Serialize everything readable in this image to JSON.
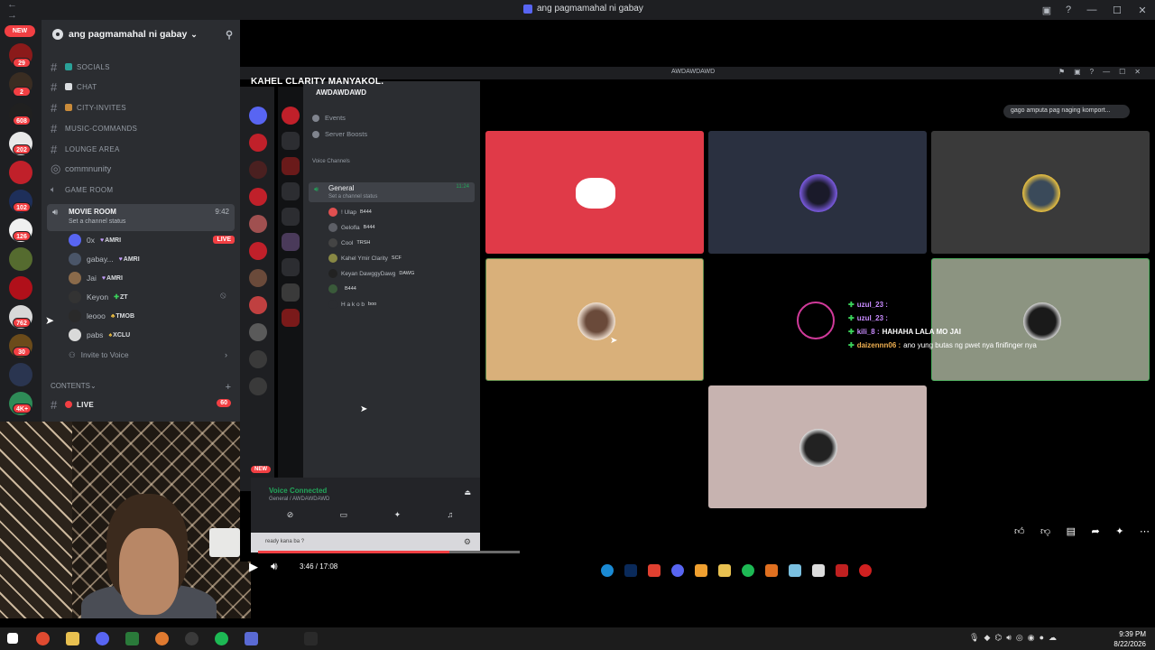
{
  "window": {
    "title": "ang pagmamahal ni gabay",
    "nav": "← →"
  },
  "rail": {
    "new_label": "NEW",
    "badges": [
      "29",
      "2",
      "608",
      "202",
      "102",
      "126",
      "762",
      "30",
      "4K+"
    ]
  },
  "server": {
    "name": "ang pagmamahal ni gabay",
    "channels": [
      {
        "label": "SOCIALS"
      },
      {
        "label": "CHAT"
      },
      {
        "label": "CITY-INVITES"
      },
      {
        "label": "MUSIC-COMMANDS"
      },
      {
        "label": "LOUNGE AREA"
      },
      {
        "label": "commnunity"
      },
      {
        "label": "GAME ROOM"
      }
    ],
    "movie_room": {
      "name": "MOVIE ROOM",
      "status": "Set a channel status",
      "time": "9:42"
    },
    "voice_users": [
      {
        "name": "0x",
        "tag": "AMRI",
        "live": "LIVE"
      },
      {
        "name": "gabay...",
        "tag": "AMRI"
      },
      {
        "name": "Jai",
        "tag": "AMRI"
      },
      {
        "name": "Keyon",
        "tag": "ZT"
      },
      {
        "name": "leooo",
        "tag": "TMOB"
      },
      {
        "name": "pabs",
        "tag": "XCLU"
      }
    ],
    "invite": "Invite to Voice",
    "contents_category": "CONTENTS",
    "live_channel": {
      "label": "LIVE",
      "count": "60"
    }
  },
  "share": {
    "overlay_title": "KAHEL CLARITY MANYAKOL.",
    "inner_window_title": "AWDAWDAWD",
    "inner_server": "AWDAWDAWD",
    "events": "Events",
    "boosts": "Server Boosts",
    "voice_category": "Voice Channels",
    "general": {
      "name": "General",
      "status": "Set a channel status",
      "time": "11:24"
    },
    "inner_users": [
      {
        "name": "! Ulap",
        "tag": "B444"
      },
      {
        "name": "Gelofla",
        "tag": "B444"
      },
      {
        "name": "Cool",
        "tag": "TRSH"
      },
      {
        "name": "Kahel Ymir Clarity",
        "tag": "SCF"
      },
      {
        "name": "Keyan DawggyDawg",
        "tag": "DAWG"
      },
      {
        "name": "",
        "tag": "B444"
      },
      {
        "name": "H a k o b",
        "tag": "boo"
      }
    ],
    "voice_connected": "Voice Connected",
    "voice_sub": "General / AWDAWDAWD",
    "new_label": "NEW",
    "user_line": "ready kana ba ?",
    "progress": 0.73
  },
  "player": {
    "time": "3:46 / 17:08",
    "progress_fraction": 0.22
  },
  "notification": "gago amputa pag naging komport...",
  "chat": [
    {
      "name": "uzul_23 :",
      "msg": "",
      "color": "#c98bff"
    },
    {
      "name": "uzul_23 :",
      "msg": "",
      "color": "#c98bff"
    },
    {
      "name": "kili_8 :",
      "msg": "HAHAHA LALA MO JAI",
      "color": "#c98bff"
    },
    {
      "name": "daizennn06 :",
      "msg": "ano yung butas ng pwet nya finifinger nya",
      "color": "#f0b050"
    }
  ],
  "taskbar": {
    "time": "9:39 PM",
    "date": "8/22/2026"
  },
  "colors": {
    "discord_red": "#e03a48",
    "blurple": "#5865f2",
    "live_red": "#f23f43",
    "green": "#23a55a"
  }
}
